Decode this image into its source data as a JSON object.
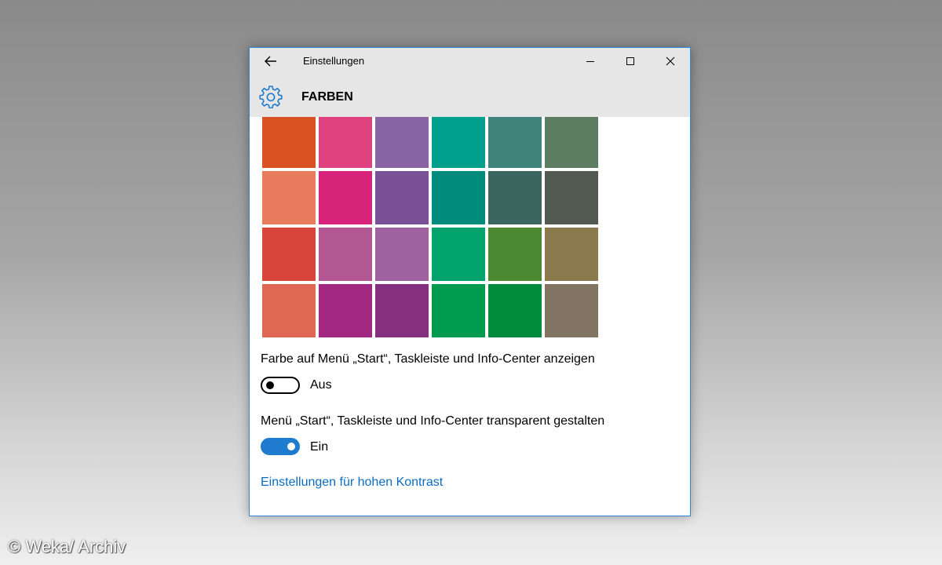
{
  "window": {
    "title": "Einstellungen",
    "accent": "#2b88d8"
  },
  "titlebar": {
    "back_icon": "arrow-left-icon",
    "minimize_icon": "minimize-icon",
    "maximize_icon": "maximize-icon",
    "close_icon": "close-icon"
  },
  "header": {
    "icon": "gear-icon",
    "title": "FARBEN"
  },
  "swatches": [
    [
      "#d85321",
      "#e0427f",
      "#8a65a6",
      "#00a08c",
      "#3e847a",
      "#5d7d62"
    ],
    [
      "#e87b5c",
      "#d8237a",
      "#7a5096",
      "#008c7c",
      "#3a665f",
      "#525a52"
    ],
    [
      "#d8453b",
      "#b45894",
      "#9e62a0",
      "#00a36c",
      "#4c8a31",
      "#8b7a4d"
    ],
    [
      "#e06752",
      "#a32882",
      "#86317f",
      "#009b4f",
      "#008c3a",
      "#827462"
    ]
  ],
  "settings": [
    {
      "label": "Farbe auf Menü „Start“, Taskleiste und Info-Center anzeigen",
      "state": "Aus",
      "on": false
    },
    {
      "label": "Menü „Start“, Taskleiste und Info-Center transparent gestalten",
      "state": "Ein",
      "on": true
    }
  ],
  "link": {
    "label": "Einstellungen für hohen Kontrast"
  },
  "watermark": "© Weka/ Archiv"
}
